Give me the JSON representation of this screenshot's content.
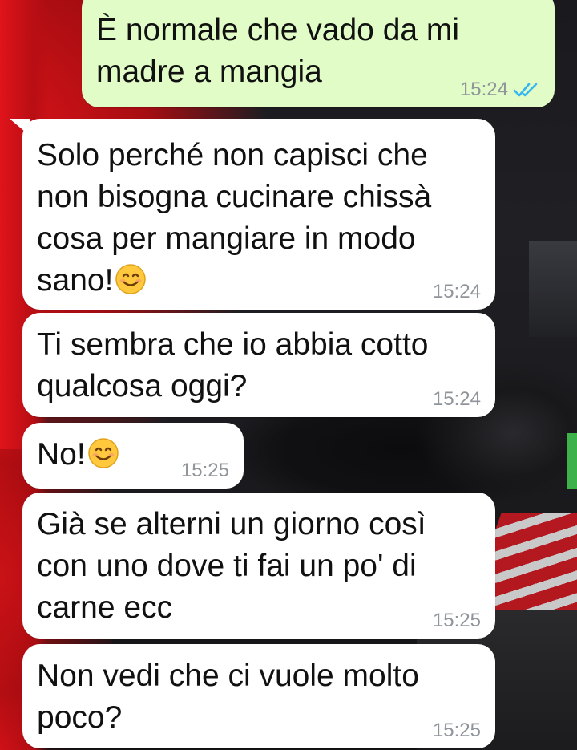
{
  "colors": {
    "outgoing_bubble": "#e1fcc6",
    "incoming_bubble": "#ffffff",
    "timestamp": "#8f959a",
    "read_ticks": "#34b7f1"
  },
  "messages": [
    {
      "direction": "outgoing",
      "text": "È normale che vado da mi\nmadre a mangia",
      "time": "15:24",
      "status_icon": "double-check-read-icon"
    },
    {
      "direction": "incoming",
      "text": "Solo perché non capisci che\nnon bisogna cucinare chissà\ncosa per mangiare in modo\nsano!",
      "emoji": "smiling-face-icon",
      "time": "15:24"
    },
    {
      "direction": "incoming",
      "text": "Ti sembra che io abbia cotto\nqualcosa oggi?",
      "time": "15:24"
    },
    {
      "direction": "incoming",
      "text": "No!",
      "emoji": "smiling-face-icon",
      "time": "15:25"
    },
    {
      "direction": "incoming",
      "text": "Già se alterni un giorno così\ncon uno dove ti fai un po' di\ncarne ecc",
      "time": "15:25"
    },
    {
      "direction": "incoming",
      "text": "Non vedi che ci vuole molto\npoco?",
      "time": "15:25"
    }
  ]
}
